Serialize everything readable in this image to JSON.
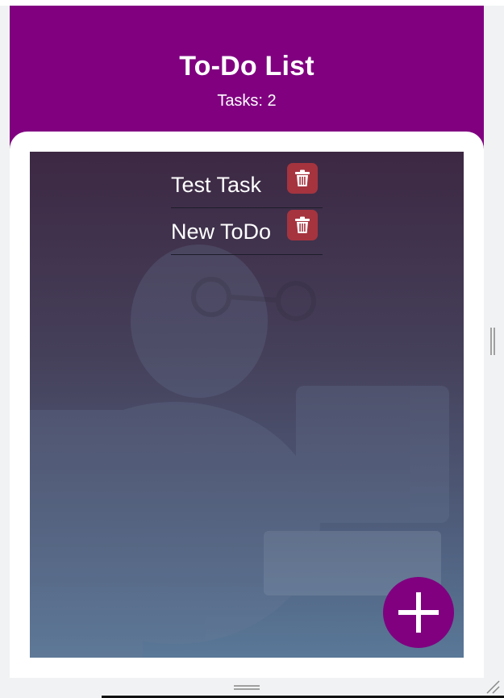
{
  "header": {
    "title": "To-Do List",
    "task_count": "Tasks: 2"
  },
  "tasks": [
    {
      "label": "Test Task"
    },
    {
      "label": "New ToDo"
    }
  ],
  "icons": {
    "delete": "trash-icon",
    "add": "plus-icon"
  },
  "colors": {
    "brand": "#800080",
    "delete": "#a5343f"
  }
}
